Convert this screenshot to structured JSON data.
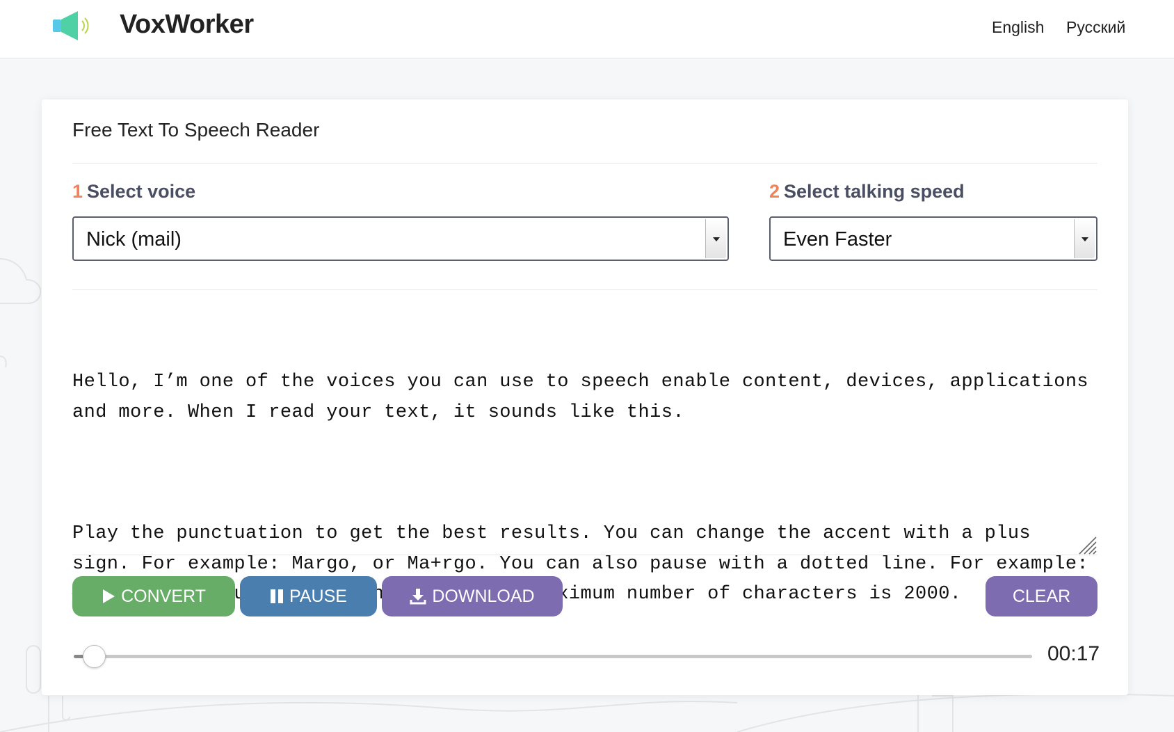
{
  "app": {
    "brand": "VoxWorker",
    "logo_icon": "speaker-icon"
  },
  "header": {
    "languages": [
      {
        "label": "English"
      },
      {
        "label": "Русский"
      }
    ]
  },
  "card": {
    "title": "Free Text To Speech Reader",
    "voice": {
      "step": "1",
      "label": "Select voice",
      "selected": "Nick (mail)"
    },
    "speed": {
      "step": "2",
      "label": "Select talking speed",
      "selected": "Even Faster"
    },
    "text": {
      "paragraph1": "Hello, I’m one of the voices you can use to speech enable content, devices, applications and more. When I read your text, it sounds like this.",
      "paragraph2": "Play the punctuation to get the best results. You can change the accent with a plus sign. For example: Margo, or Ma+rgo. You can also pause with a dotted line. For example: —— it was a pause. Please note that the maximum number of characters is 2000."
    },
    "buttons": {
      "convert": "CONVERT",
      "pause": "PAUSE",
      "download": "DOWNLOAD",
      "clear": "CLEAR"
    },
    "player": {
      "progress": 0.01,
      "time": "00:17"
    }
  },
  "colors": {
    "step_number": "#f0825c",
    "convert": "#67ad67",
    "pause": "#4a7eaf",
    "download": "#7e6cb0",
    "clear": "#7e6cb0",
    "logo_speaker": "#4fd1a5",
    "logo_waves": "#b6d34a"
  }
}
